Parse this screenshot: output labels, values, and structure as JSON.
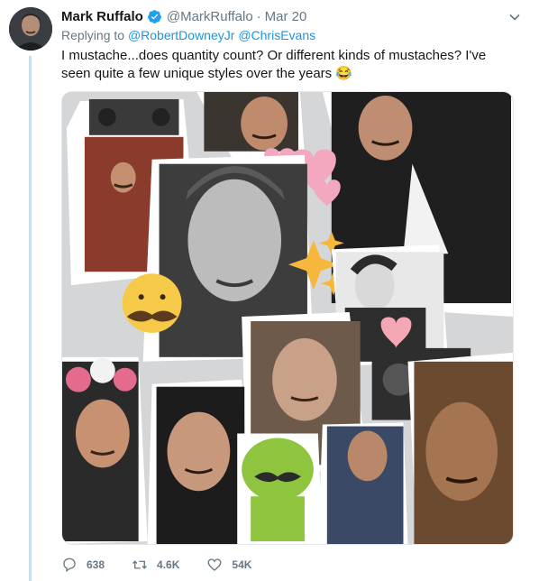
{
  "tweet": {
    "author_name": "Mark Ruffalo",
    "author_handle": "@MarkRuffalo",
    "separator": "·",
    "timestamp": "Mar 20",
    "replying_label": "Replying to",
    "replying_mentions": [
      "@RobertDowneyJr",
      "@ChrisEvans"
    ],
    "text": "I mustache...does quantity count? Or different kinds of mustaches? I've seen quite a few unique styles over the years 😂"
  },
  "actions": {
    "reply_count": "638",
    "retweet_count": "4.6K",
    "like_count": "54K"
  },
  "icons": {
    "verified": "verified-badge-icon",
    "caret": "chevron-down-icon",
    "reply": "reply-icon",
    "retweet": "retweet-icon",
    "like": "heart-icon"
  },
  "colors": {
    "link": "#1b95e0",
    "muted": "#657786",
    "thread": "#c8dfef",
    "verified": "#1da1f2"
  }
}
